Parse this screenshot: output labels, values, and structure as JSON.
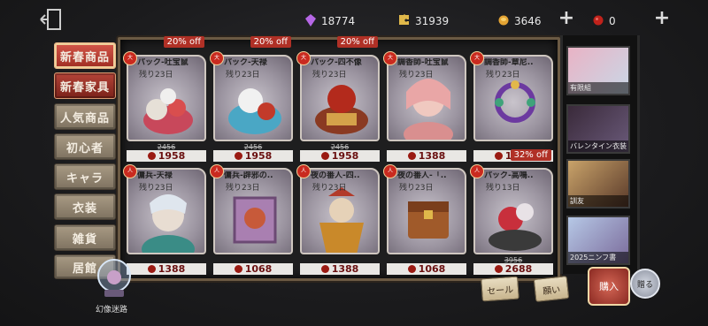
{
  "currencies": [
    {
      "name": "crystal",
      "value": "18774",
      "color": "#b667e6"
    },
    {
      "name": "clue",
      "value": "31939",
      "color": "#e0b84a"
    },
    {
      "name": "echo",
      "value": "3646",
      "color": "#e3a333"
    },
    {
      "name": "ruby",
      "value": "0",
      "color": "#c0221b"
    }
  ],
  "tabs": [
    {
      "label": "新春商品",
      "state": "active"
    },
    {
      "label": "新春家具",
      "state": "red"
    },
    {
      "label": "人気商品",
      "state": "normal"
    },
    {
      "label": "初心者",
      "state": "normal"
    },
    {
      "label": "キャラ",
      "state": "normal"
    },
    {
      "label": "衣装",
      "state": "normal"
    },
    {
      "label": "雑貨",
      "state": "normal"
    },
    {
      "label": "居館",
      "state": "normal"
    }
  ],
  "cards": [
    {
      "title": "パック-吐宝鼠",
      "sub": "残り23日",
      "badge": "大",
      "discount": "20% off",
      "orig": "2456",
      "price": "1958"
    },
    {
      "title": "パック-天禄",
      "sub": "残り23日",
      "badge": "大",
      "discount": "20% off",
      "orig": "2456",
      "price": "1958"
    },
    {
      "title": "パック-四不像",
      "sub": "残り23日",
      "badge": "大",
      "discount": "20% off",
      "orig": "2456",
      "price": "1958"
    },
    {
      "title": "調香師-吐宝鼠",
      "sub": "残り23日",
      "badge": "大",
      "discount": "",
      "orig": "",
      "price": "1388"
    },
    {
      "title": "調香師-章尼..",
      "sub": "残り23日",
      "badge": "大",
      "discount": "",
      "orig": "",
      "price": "1068"
    },
    {
      "title": "傭兵-天禄",
      "sub": "残り23日",
      "badge": "人",
      "discount": "",
      "orig": "",
      "price": "1388"
    },
    {
      "title": "傭兵-辟邪の..",
      "sub": "残り23日",
      "badge": "人",
      "discount": "",
      "orig": "",
      "price": "1068"
    },
    {
      "title": "夜の番人-四..",
      "sub": "残り23日",
      "badge": "人",
      "discount": "",
      "orig": "",
      "price": "1388"
    },
    {
      "title": "夜の番人-「..",
      "sub": "残り23日",
      "badge": "人",
      "discount": "",
      "orig": "",
      "price": "1068"
    },
    {
      "title": "パック-高鳴..",
      "sub": "残り13日",
      "badge": "人",
      "discount": "32% off",
      "orig": "3956",
      "price": "2688"
    }
  ],
  "side_items": [
    {
      "label": "有限組"
    },
    {
      "label": "バレンタイン衣装"
    },
    {
      "label": "訓友"
    },
    {
      "label": "2025ニンフ書"
    }
  ],
  "buttons": {
    "sale": "セール",
    "want": "願い",
    "buy": "購入",
    "gift": "贈る"
  },
  "maze_label": "幻像迷路"
}
